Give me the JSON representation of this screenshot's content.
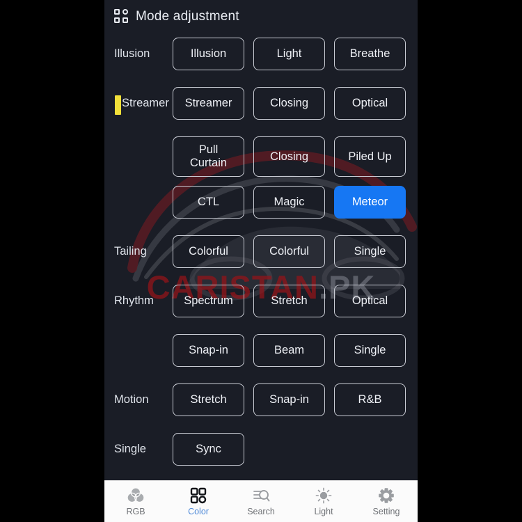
{
  "header": {
    "icon": "grid-apps-icon",
    "title": "Mode adjustment"
  },
  "colors": {
    "accent_selected": "#1677f3",
    "panel_background": "#1a1d26",
    "button_border": "#c9ccd4",
    "marker_yellow": "#f2e03a",
    "nav_active": "#4f8ad8",
    "watermark_red": "#961419"
  },
  "watermark": {
    "text_main": "CARISTAN",
    "text_suffix": ".PK",
    "graphic": "car-silhouette"
  },
  "mode_rows": [
    {
      "label": "Illusion",
      "marker": false,
      "buttons": [
        {
          "label": "Illusion",
          "selected": false
        },
        {
          "label": "Light",
          "selected": false
        },
        {
          "label": "Breathe",
          "selected": false
        }
      ]
    },
    {
      "label": "Streamer",
      "marker": true,
      "buttons": [
        {
          "label": "Streamer",
          "selected": false
        },
        {
          "label": "Closing",
          "selected": false
        },
        {
          "label": "Optical",
          "selected": false
        }
      ]
    },
    {
      "label": "",
      "marker": false,
      "tall": true,
      "buttons": [
        {
          "label": "Pull\nCurtain",
          "selected": false
        },
        {
          "label": "Closing",
          "selected": false
        },
        {
          "label": "Piled Up",
          "selected": false
        }
      ]
    },
    {
      "label": "",
      "marker": false,
      "buttons": [
        {
          "label": "CTL",
          "selected": false
        },
        {
          "label": "Magic",
          "selected": false
        },
        {
          "label": "Meteor",
          "selected": true
        }
      ]
    },
    {
      "label": "Tailing",
      "marker": false,
      "buttons": [
        {
          "label": "Colorful",
          "selected": false
        },
        {
          "label": "Colorful",
          "selected": false
        },
        {
          "label": "Single",
          "selected": false
        }
      ]
    },
    {
      "label": "Rhythm",
      "marker": false,
      "buttons": [
        {
          "label": "Spectrum",
          "selected": false
        },
        {
          "label": "Stretch",
          "selected": false
        },
        {
          "label": "Optical",
          "selected": false
        }
      ]
    },
    {
      "label": "",
      "marker": false,
      "buttons": [
        {
          "label": "Snap-in",
          "selected": false
        },
        {
          "label": "Beam",
          "selected": false
        },
        {
          "label": "Single",
          "selected": false
        }
      ]
    },
    {
      "label": "Motion",
      "marker": false,
      "buttons": [
        {
          "label": "Stretch",
          "selected": false
        },
        {
          "label": "Snap-in",
          "selected": false
        },
        {
          "label": "R&B",
          "selected": false
        }
      ]
    },
    {
      "label": "Single",
      "marker": false,
      "buttons": [
        {
          "label": "Sync",
          "selected": false
        }
      ]
    }
  ],
  "bottom_nav": {
    "items": [
      {
        "label": "RGB",
        "icon": "rgb-venn-icon",
        "active": false
      },
      {
        "label": "Color",
        "icon": "grid-apps-icon",
        "active": true
      },
      {
        "label": "Search",
        "icon": "search-list-icon",
        "active": false
      },
      {
        "label": "Light",
        "icon": "sun-icon",
        "active": false
      },
      {
        "label": "Setting",
        "icon": "gear-icon",
        "active": false
      }
    ]
  }
}
